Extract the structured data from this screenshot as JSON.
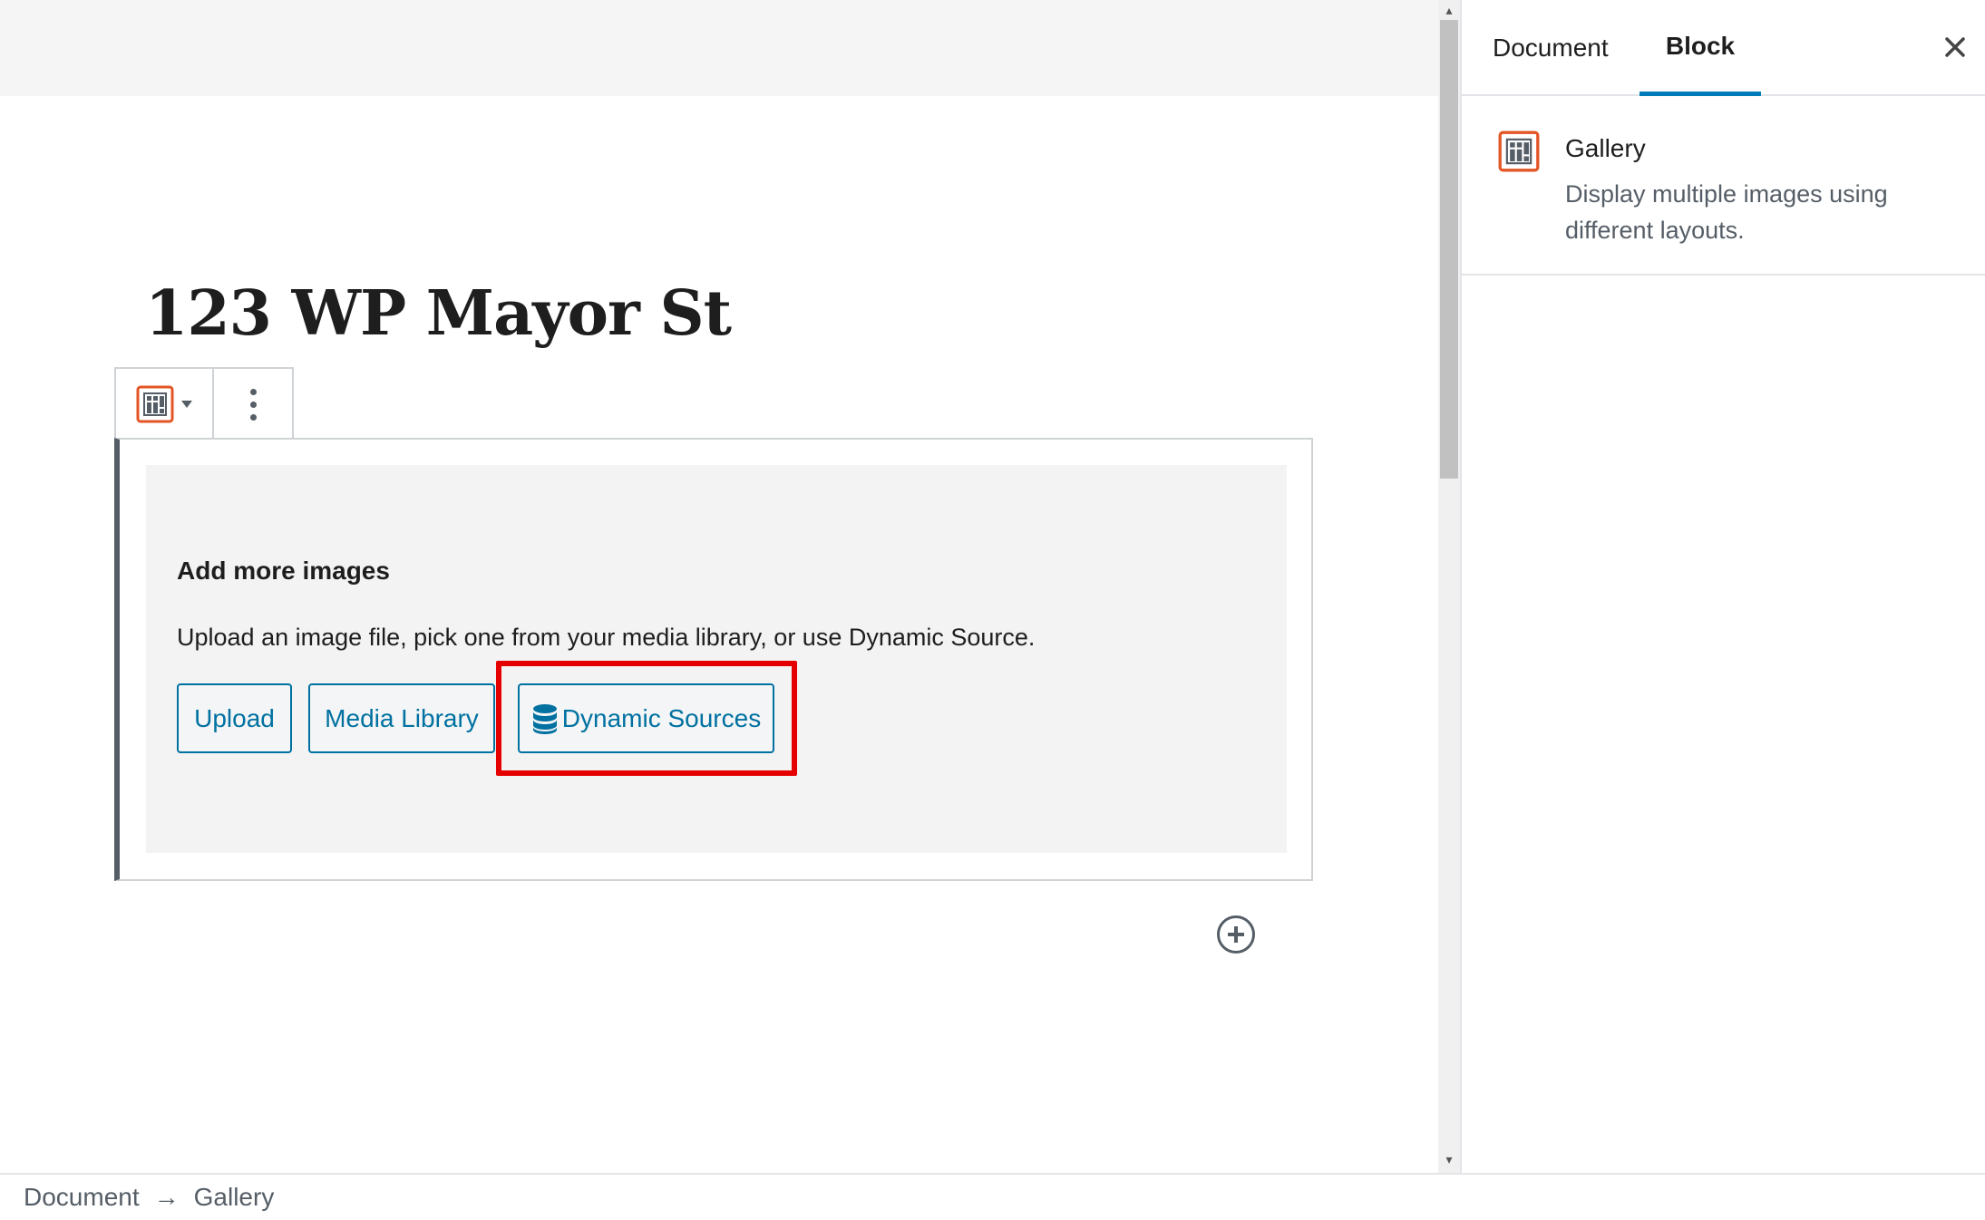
{
  "editor": {
    "post_title": "123 WP Mayor St"
  },
  "block_toolbar": {
    "block_icon": "gallery-icon",
    "more_icon": "more-vertical-icon"
  },
  "gallery_placeholder": {
    "title": "Add more images",
    "instructions": "Upload an image file, pick one from your media library, or use Dynamic Source.",
    "buttons": {
      "upload": "Upload",
      "media_library": "Media Library",
      "dynamic_sources": "Dynamic Sources"
    }
  },
  "sidebar": {
    "tabs": [
      {
        "label": "Document",
        "active": false
      },
      {
        "label": "Block",
        "active": true
      }
    ],
    "block_card": {
      "title": "Gallery",
      "description": "Display multiple images using different layouts."
    }
  },
  "breadcrumb": {
    "items": [
      "Document",
      "Gallery"
    ],
    "separator": "→"
  },
  "colors": {
    "accent": "#007cba",
    "button_text": "#0071a1",
    "block_icon": "#e35525",
    "highlight": "#e50000"
  }
}
